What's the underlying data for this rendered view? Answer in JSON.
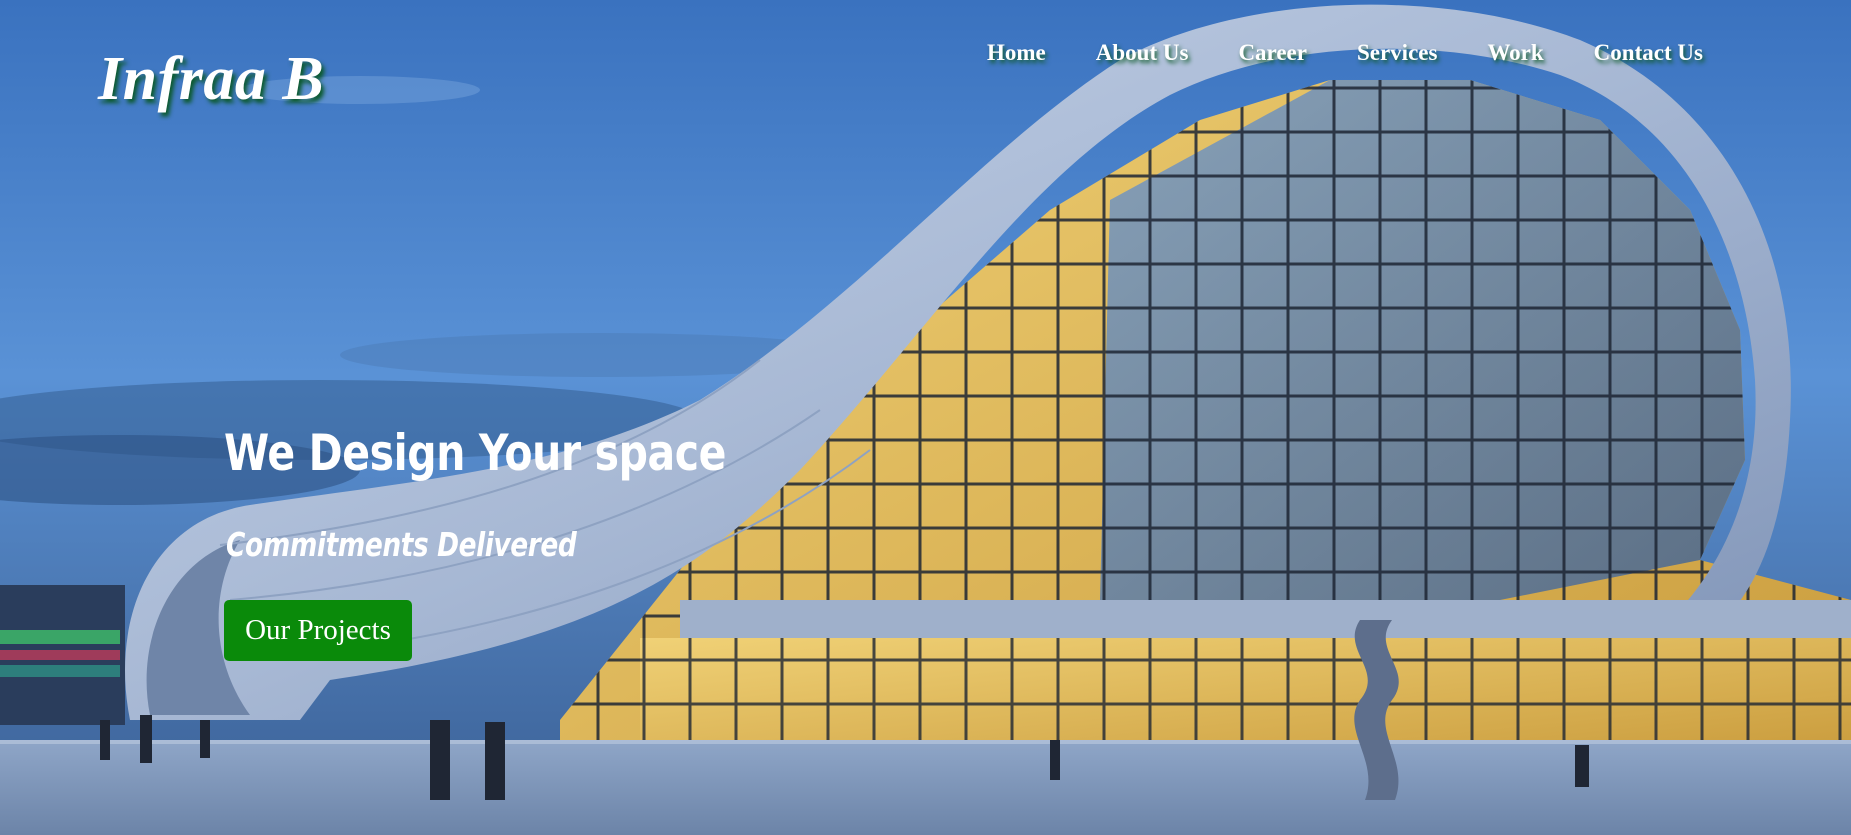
{
  "brand": {
    "logo_text": "Infraa B"
  },
  "nav": {
    "items": [
      {
        "label": "Home"
      },
      {
        "label": "About Us"
      },
      {
        "label": "Career"
      },
      {
        "label": "Services"
      },
      {
        "label": "Work"
      },
      {
        "label": "Contact Us"
      }
    ]
  },
  "hero": {
    "headline": "We Design Your space",
    "tagline": "Commitments Delivered",
    "cta_label": "Our Projects",
    "background_subject": "curved-glass-building-photo"
  },
  "colors": {
    "sky_top": "#3a74c0",
    "sky_bottom": "#6fa2dc",
    "cta_green": "#0a8a0a",
    "text_shadow_green": "#0c5a2e",
    "glass_warm": "#e8c25a",
    "glass_blue": "#5b86c2"
  }
}
